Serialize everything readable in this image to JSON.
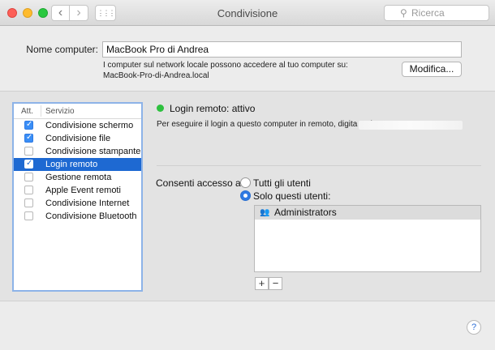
{
  "window": {
    "title": "Condivisione",
    "search_placeholder": "Ricerca",
    "back_icon": "‹",
    "forward_icon": "›",
    "grid_icon": "⋮⋮⋮"
  },
  "computer": {
    "name_label": "Nome computer:",
    "name_value": "MacBook Pro di Andrea",
    "info_line1": "I computer sul network locale possono accedere al tuo computer su:",
    "info_line2": "MacBook-Pro-di-Andrea.local",
    "edit_button": "Modifica..."
  },
  "services": {
    "col_on": "Att.",
    "col_service": "Servizio",
    "items": [
      {
        "label": "Condivisione schermo",
        "checked": true,
        "selected": false
      },
      {
        "label": "Condivisione file",
        "checked": true,
        "selected": false
      },
      {
        "label": "Condivisione stampante",
        "checked": false,
        "selected": false
      },
      {
        "label": "Login remoto",
        "checked": true,
        "selected": true
      },
      {
        "label": "Gestione remota",
        "checked": false,
        "selected": false
      },
      {
        "label": "Apple Event remoti",
        "checked": false,
        "selected": false
      },
      {
        "label": "Condivisione Internet",
        "checked": false,
        "selected": false
      },
      {
        "label": "Condivisione Bluetooth",
        "checked": false,
        "selected": false
      }
    ]
  },
  "detail": {
    "status": "Login remoto: attivo",
    "status_color": "#2ec13f",
    "description": "Per eseguire il login a questo computer in remoto, digita \"ssh a",
    "access_label": "Consenti accesso a:",
    "option_all": "Tutti gli utenti",
    "option_only": "Solo questi utenti:",
    "selected_option": "only",
    "users": [
      "Administrators"
    ],
    "add_button": "+",
    "remove_button": "−"
  },
  "help_button": "?"
}
